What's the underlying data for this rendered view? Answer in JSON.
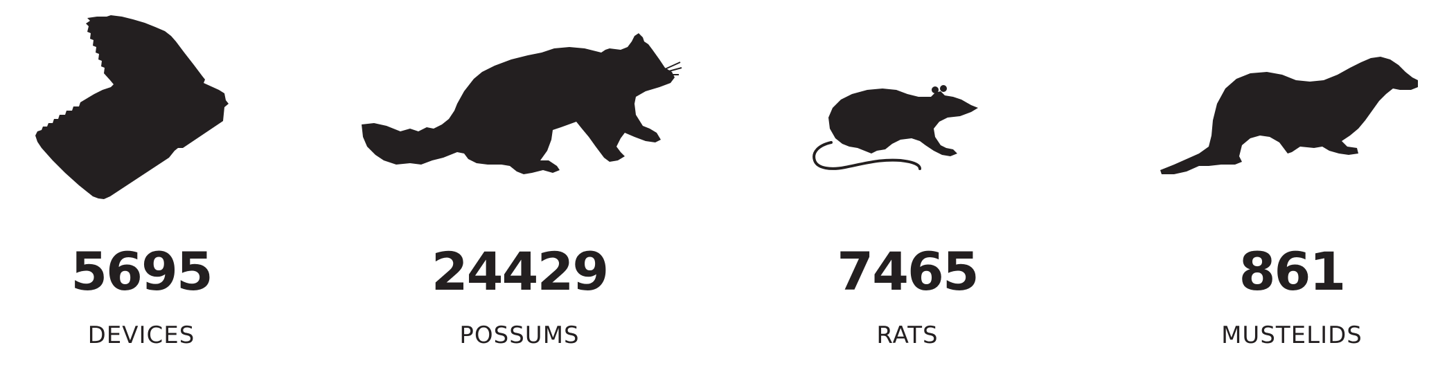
{
  "colors": {
    "ink": "#231f20",
    "background": "#ffffff"
  },
  "stats": [
    {
      "icon": "trap-device-icon",
      "value": "5695",
      "label": "DEVICES"
    },
    {
      "icon": "possum-icon",
      "value": "24429",
      "label": "POSSUMS"
    },
    {
      "icon": "rat-icon",
      "value": "7465",
      "label": "RATS"
    },
    {
      "icon": "mustelid-icon",
      "value": "861",
      "label": "MUSTELIDS"
    }
  ]
}
